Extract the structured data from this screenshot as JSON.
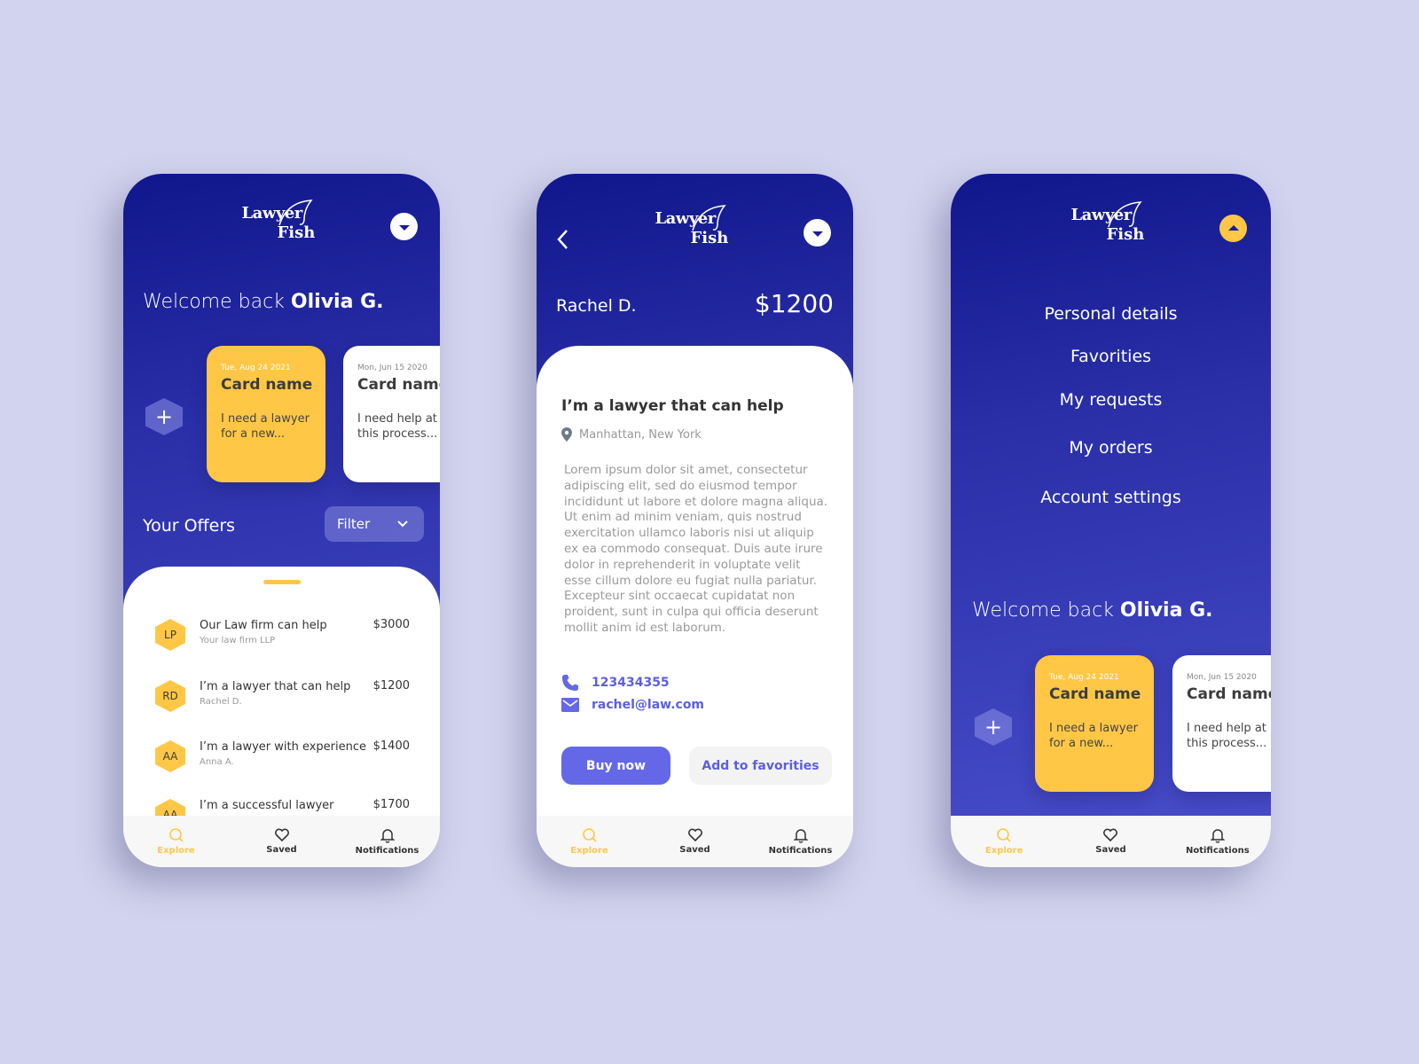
{
  "app": {
    "logo_line1": "Lawyer",
    "logo_line2": "Fish"
  },
  "colors": {
    "primary_dark": "#10168c",
    "primary": "#4a4fcc",
    "accent_yellow": "#ffc745",
    "link_blue": "#5b5fe0",
    "background": "#d2d3ee"
  },
  "home": {
    "welcome_prefix": "Welcome back ",
    "user_name": "Olivia G.",
    "add_icon": "plus-icon",
    "cards": [
      {
        "date": "Tue, Aug 24 2021",
        "name": "Card name",
        "desc": "I need a lawyer for a new..."
      },
      {
        "date": "Mon, Jun 15 2020",
        "name": "Card name",
        "desc": "I need help at this process..."
      }
    ],
    "offers_title": "Your Offers",
    "filter_label": "Filter",
    "offers": [
      {
        "initials": "LP",
        "title": "Our Law firm can help",
        "subtitle": "Your law firm LLP",
        "price": "$3000"
      },
      {
        "initials": "RD",
        "title": "I’m a lawyer that can help",
        "subtitle": "Rachel D.",
        "price": "$1200"
      },
      {
        "initials": "AA",
        "title": "I’m a lawyer with experience",
        "subtitle": "Anna A.",
        "price": "$1400"
      },
      {
        "initials": "AA",
        "title": "I’m a successful lawyer",
        "subtitle": "",
        "price": "$1700"
      }
    ]
  },
  "detail": {
    "name": "Rachel D.",
    "price": "$1200",
    "title": "I’m a lawyer that can help",
    "location": "Manhattan, New York",
    "body": "Lorem ipsum dolor sit amet, consectetur adipiscing elit, sed do eiusmod tempor incididunt ut labore et dolore magna aliqua. Ut enim ad minim veniam, quis nostrud exercitation ullamco laboris nisi ut aliquip ex ea commodo consequat. Duis aute irure dolor in reprehenderit in voluptate velit esse cillum dolore eu fugiat nulla pariatur. Excepteur sint occaecat cupidatat non proident, sunt in culpa qui officia deserunt mollit anim id est laborum.",
    "phone": "123434355",
    "email": "rachel@law.com",
    "buy_label": "Buy now",
    "fav_label": "Add to favorities"
  },
  "menu": {
    "items": [
      "Personal details",
      "Favorities",
      "My requests",
      "My orders",
      "Account settings"
    ]
  },
  "tabbar": {
    "tabs": [
      {
        "label": "Explore",
        "icon": "search-icon",
        "active": true
      },
      {
        "label": "Saved",
        "icon": "heart-icon",
        "active": false
      },
      {
        "label": "Notifications",
        "icon": "bell-icon",
        "active": false
      }
    ]
  }
}
